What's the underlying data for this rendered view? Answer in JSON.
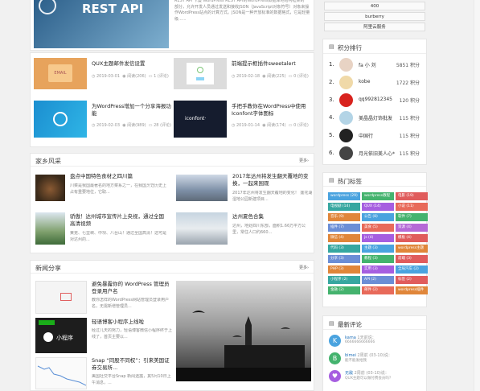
{
  "top_post": {
    "image_label": "REST API",
    "excerpt": "REST API 卡曼 WordPress REST API的WordPress数据库地结构框架的一部分，允许开发人员通过发送和接收JSON（JavaScript对象符号）对象来操作WordPress站点的计算方式。JSON是一种开放标准的数据格式，它是轻量级......"
  },
  "posts": [
    {
      "title": "QUX主题邮件发信设置",
      "date": "2019-03-01",
      "views": "阅读(206)",
      "comments": "1 (评论)",
      "thumb_label": "EMAIL"
    },
    {
      "title": "前端提示框插件sweetalert",
      "date": "2019-02-18",
      "views": "阅读(225)",
      "comments": "0 (评论)",
      "thumb_label": ""
    },
    {
      "title": "为WordPress增加一个分享海报功能",
      "date": "2019-02-03",
      "views": "阅读(989)",
      "comments": "28 (评论)",
      "thumb_label": ""
    },
    {
      "title": "手把手教你在WordPress中使用Iconfont字体图标",
      "date": "2019-01-14",
      "views": "阅读(174)",
      "comments": "0 (评论)",
      "thumb_label": "iconfont·"
    }
  ],
  "hometown": {
    "title": "家乡风采",
    "more": "更多›",
    "items": [
      {
        "title": "盘点中国特色食材之四川篇",
        "excerpt": "川菜是我国最著名的地方菜系之一，在我国烹饪历史上占有重要地位，它取..."
      },
      {
        "title": "2017年达州将发生翻天覆地的变换，一起来围观",
        "excerpt": "2017年达州将发生翻天覆地的变化！ 莲花湖湿地公园新建项目..."
      },
      {
        "title": "骄傲！达州城市宣传片上央视，通过全国高清视频",
        "excerpt": "莱芜、七里峡、中坝、八台山！通过全国高清！这可是对达州的..."
      },
      {
        "title": "达州夏色合集",
        "excerpt": "达州，地处四川东部，面积1.66万平方公里，常住人口约660..."
      }
    ]
  },
  "news": {
    "title": "新闻分享",
    "more": "更多›",
    "items": [
      {
        "title": "避免暴露你的 WordPress 管理员登录用户名",
        "excerpt": "教你怎样的WordPress网站管理员登录用户名，无需新增管理员..."
      },
      {
        "title": "轻语博客小程序上线啦",
        "excerpt": "经过几天的努力，轻语博客微信小程序终于上线了，首页主要以..."
      },
      {
        "title": "Snap “同股不同权”：引来美国证券交易所...",
        "excerpt": "美国社交平台Snap 新闻透露，其5月10日上午消息，..."
      }
    ]
  },
  "sidebar_top_pills": [
    "400",
    "burberry",
    "阿里云服务"
  ],
  "ranking": {
    "title": "积分排行",
    "rows": [
      {
        "rank": "1.",
        "name": "fa 小 刘",
        "points": "5851 积分",
        "color": "#e8d3c4"
      },
      {
        "rank": "2.",
        "name": "kobe",
        "points": "1722 积分",
        "color": "#f0d9a8"
      },
      {
        "rank": "3.",
        "name": "qq992812345",
        "points": "120 积分",
        "color": "#d8231e"
      },
      {
        "rank": "4.",
        "name": "美晶晶灯饰批发",
        "points": "115 积分",
        "color": "#b3d4e6"
      },
      {
        "rank": "5.",
        "name": "中国行",
        "points": "115 积分",
        "color": "#222"
      },
      {
        "rank": "6.",
        "name": "月光依旧美人心*",
        "points": "115 积分",
        "color": "#444"
      }
    ]
  },
  "tags": {
    "title": "热门标签",
    "items": [
      {
        "label": "wordpress (29)",
        "color": "#4aa3df"
      },
      {
        "label": "wordpress教程",
        "color": "#44b36e"
      },
      {
        "label": "电影 (19)",
        "color": "#e05c5c"
      },
      {
        "label": "电视剧 (14)",
        "color": "#36a7a0"
      },
      {
        "label": "QUX (14)",
        "color": "#a65ee0"
      },
      {
        "label": "小说 (11)",
        "color": "#e86a5a"
      },
      {
        "label": "音乐 (9)",
        "color": "#e0863a"
      },
      {
        "label": "公告 (8)",
        "color": "#4aa3df"
      },
      {
        "label": "软件 (7)",
        "color": "#44b36e"
      },
      {
        "label": "插件 (7)",
        "color": "#6b8ed6"
      },
      {
        "label": "美食 (5)",
        "color": "#e86a5a"
      },
      {
        "label": "资源 (4)",
        "color": "#b56ad6"
      },
      {
        "label": "微信 (4)",
        "color": "#e0863a"
      },
      {
        "label": "js (4)",
        "color": "#a65ee0"
      },
      {
        "label": "模板 (4)",
        "color": "#e05c5c"
      },
      {
        "label": "代码 (3)",
        "color": "#36a7a0"
      },
      {
        "label": "主题 (3)",
        "color": "#4aa3df"
      },
      {
        "label": "wordpress主题",
        "color": "#e0863a"
      },
      {
        "label": "分享 (3)",
        "color": "#6b8ed6"
      },
      {
        "label": "教程 (3)",
        "color": "#44b36e"
      },
      {
        "label": "前端 (3)",
        "color": "#e05c5c"
      },
      {
        "label": "PHP (3)",
        "color": "#e0863a"
      },
      {
        "label": "实用 (3)",
        "color": "#a65ee0"
      },
      {
        "label": "全局汽车 (2)",
        "color": "#4aa3df"
      },
      {
        "label": "小程序 (2)",
        "color": "#36a7a0"
      },
      {
        "label": "API (2)",
        "color": "#6b8ed6"
      },
      {
        "label": "标签 (2)",
        "color": "#e05c5c"
      },
      {
        "label": "金融 (2)",
        "color": "#44b36e"
      },
      {
        "label": "邮件 (2)",
        "color": "#e86a5a"
      },
      {
        "label": "wordpress插件",
        "color": "#e0863a"
      }
    ]
  },
  "comments": {
    "title": "最新评论",
    "items": [
      {
        "initial": "K",
        "name": "kama",
        "meta": "1天前说：",
        "text": "6666666666666",
        "color": "#4aa3df"
      },
      {
        "initial": "B",
        "name": "bimei",
        "meta": "2周前 (03-10)说：",
        "text": "能不能发给我",
        "color": "#44b36e"
      },
      {
        "initial": "♥",
        "name": "无敌",
        "meta": "2周前 (03-10)说：",
        "text": "QUX主题可以做付费会员吗？",
        "color": "#a65ee0"
      }
    ]
  }
}
